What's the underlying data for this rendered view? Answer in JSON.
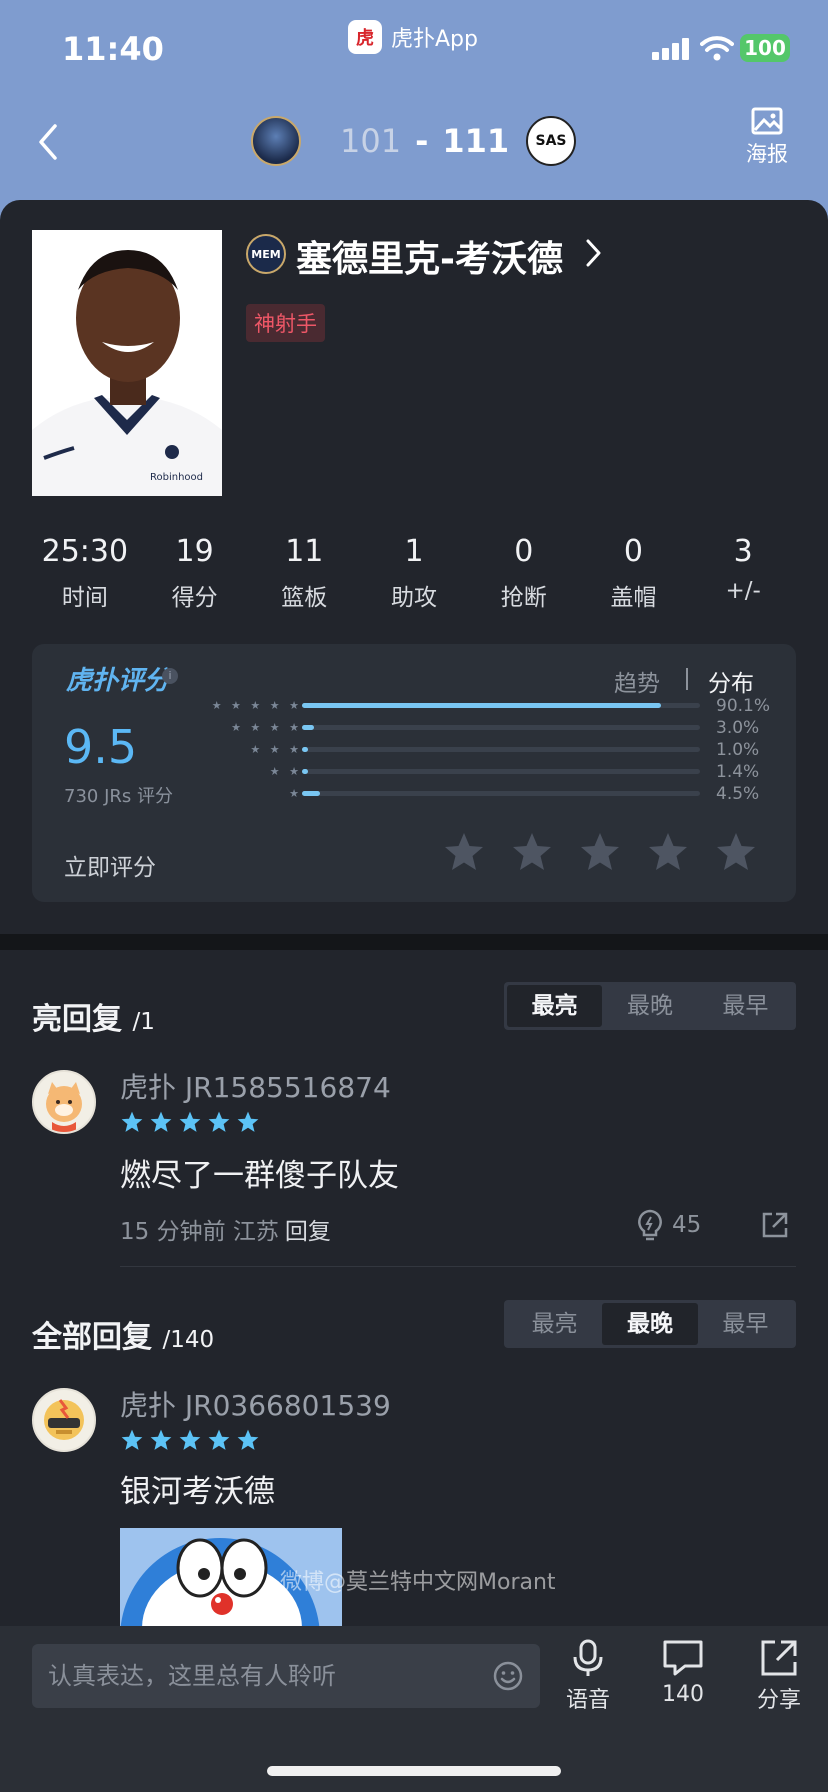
{
  "status_bar": {
    "time": "11:40",
    "app_logo_glyph": "虎",
    "app_name": "虎扑App",
    "battery": "100"
  },
  "nav": {
    "home_score": "101",
    "separator": "-",
    "away_score": "111",
    "away_team_abbr": "SAS",
    "poster_label": "海报"
  },
  "player": {
    "team_abbr": "MEM",
    "name": "塞德里克-考沃德",
    "tag": "神射手",
    "jersey_sponsor": "Robinhood"
  },
  "stats": [
    {
      "value": "25:30",
      "label": "时间"
    },
    {
      "value": "19",
      "label": "得分"
    },
    {
      "value": "11",
      "label": "篮板"
    },
    {
      "value": "1",
      "label": "助攻"
    },
    {
      "value": "0",
      "label": "抢断"
    },
    {
      "value": "0",
      "label": "盖帽"
    },
    {
      "value": "3",
      "label": "+/-"
    }
  ],
  "rating": {
    "logo_text": "虎扑评分",
    "score": "9.5",
    "count_text": "730 JRs 评分",
    "trend_tab": "趋势",
    "dist_tab": "分布",
    "distribution": [
      {
        "stars": "★ ★ ★ ★ ★",
        "pct_label": "90.1%",
        "fraction": 0.901
      },
      {
        "stars": "★ ★ ★ ★",
        "pct_label": "3.0%",
        "fraction": 0.03
      },
      {
        "stars": "★ ★ ★",
        "pct_label": "1.0%",
        "fraction": 0.01
      },
      {
        "stars": "★ ★",
        "pct_label": "1.4%",
        "fraction": 0.014
      },
      {
        "stars": "★",
        "pct_label": "4.5%",
        "fraction": 0.045
      }
    ],
    "rate_now": "立即评分"
  },
  "highlight_section": {
    "title": "亮回复",
    "count": "/1",
    "sort_options": [
      "最亮",
      "最晚",
      "最早"
    ],
    "active_sort": 0,
    "comments": [
      {
        "username": "虎扑 JR1585516874",
        "text": "燃尽了一群傻子队友",
        "meta": "15 分钟前  江苏",
        "reply_label": "回复",
        "light_count": "45"
      }
    ]
  },
  "all_section": {
    "title": "全部回复",
    "count": "/140",
    "sort_options": [
      "最亮",
      "最晚",
      "最早"
    ],
    "active_sort": 1,
    "comments": [
      {
        "username": "虎扑 JR0366801539",
        "text": "银河考沃德"
      }
    ]
  },
  "bottom_bar": {
    "input_placeholder": "认真表达，这里总有人聆听",
    "voice_label": "语音",
    "comments_label": "140",
    "share_label": "分享"
  },
  "watermark": "微博@莫兰特中文网Morant",
  "colors": {
    "header_bg": "#7f9ccf",
    "card_bg": "#22252c",
    "accent_blue": "#5bb8f5",
    "tag_red": "#ee5767"
  }
}
